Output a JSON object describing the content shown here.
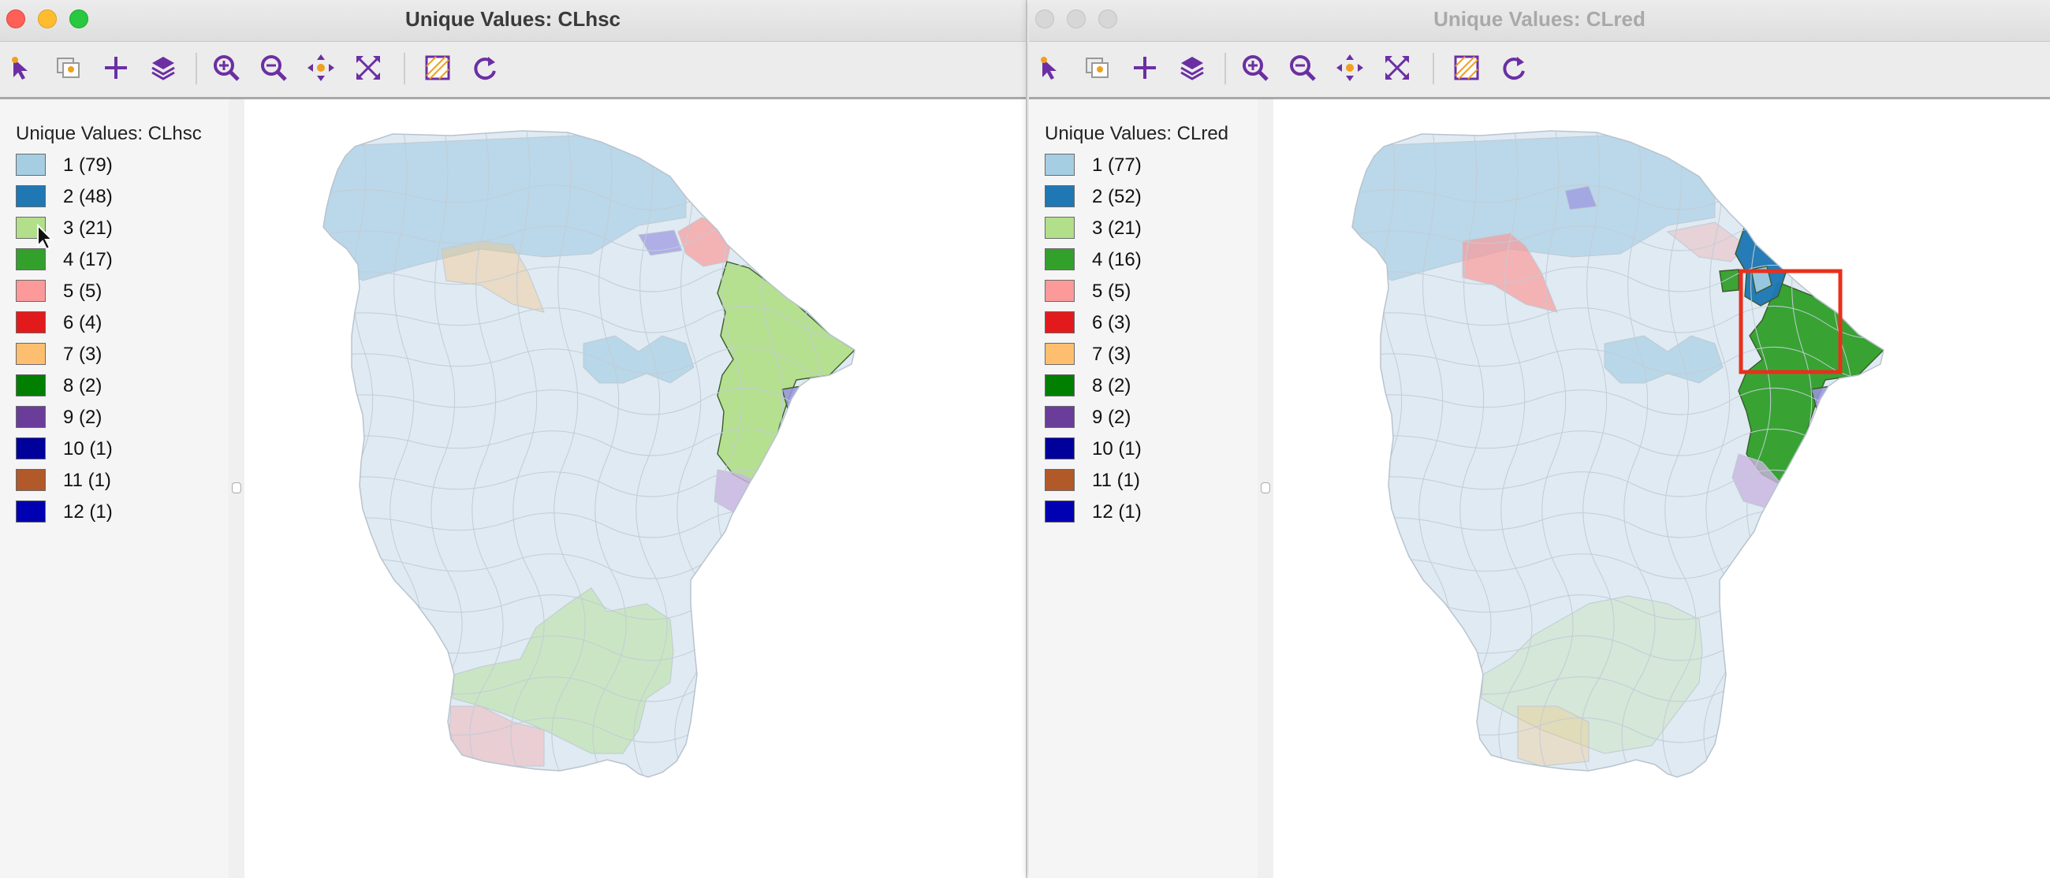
{
  "left_window": {
    "title": "Unique Values: CLhsc",
    "legend_title": "Unique Values: CLhsc",
    "legend": [
      {
        "label": "1 (79)",
        "color": "#a6cee3"
      },
      {
        "label": "2 (48)",
        "color": "#1f78b4"
      },
      {
        "label": "3 (21)",
        "color": "#b2df8a"
      },
      {
        "label": "4 (17)",
        "color": "#33a02c"
      },
      {
        "label": "5 (5)",
        "color": "#fb9a99"
      },
      {
        "label": "6 (4)",
        "color": "#e31a1c"
      },
      {
        "label": "7 (3)",
        "color": "#fdbf6f"
      },
      {
        "label": "8 (2)",
        "color": "#007f00"
      },
      {
        "label": "9 (2)",
        "color": "#6a3d9a"
      },
      {
        "label": "10 (1)",
        "color": "#00009b"
      },
      {
        "label": "11 (1)",
        "color": "#b15928"
      },
      {
        "label": "12 (1)",
        "color": "#0000b3"
      }
    ]
  },
  "right_window": {
    "title": "Unique Values: CLred",
    "legend_title": "Unique Values: CLred",
    "legend": [
      {
        "label": "1 (77)",
        "color": "#a6cee3"
      },
      {
        "label": "2 (52)",
        "color": "#1f78b4"
      },
      {
        "label": "3 (21)",
        "color": "#b2df8a"
      },
      {
        "label": "4 (16)",
        "color": "#33a02c"
      },
      {
        "label": "5 (5)",
        "color": "#fb9a99"
      },
      {
        "label": "6 (3)",
        "color": "#e31a1c"
      },
      {
        "label": "7 (3)",
        "color": "#fdbf6f"
      },
      {
        "label": "8 (2)",
        "color": "#007f00"
      },
      {
        "label": "9 (2)",
        "color": "#6a3d9a"
      },
      {
        "label": "10 (1)",
        "color": "#00009b"
      },
      {
        "label": "11 (1)",
        "color": "#b15928"
      },
      {
        "label": "12 (1)",
        "color": "#0000b3"
      }
    ]
  },
  "toolbar_icons": [
    "select-icon",
    "copy-image-icon",
    "add-layer-icon",
    "layers-icon",
    "zoom-in-icon",
    "zoom-out-icon",
    "pan-icon",
    "full-extent-icon",
    "basemap-icon",
    "refresh-icon"
  ],
  "colors": {
    "accent": "#6b2fa3",
    "highlight_box": "#e8301d"
  }
}
